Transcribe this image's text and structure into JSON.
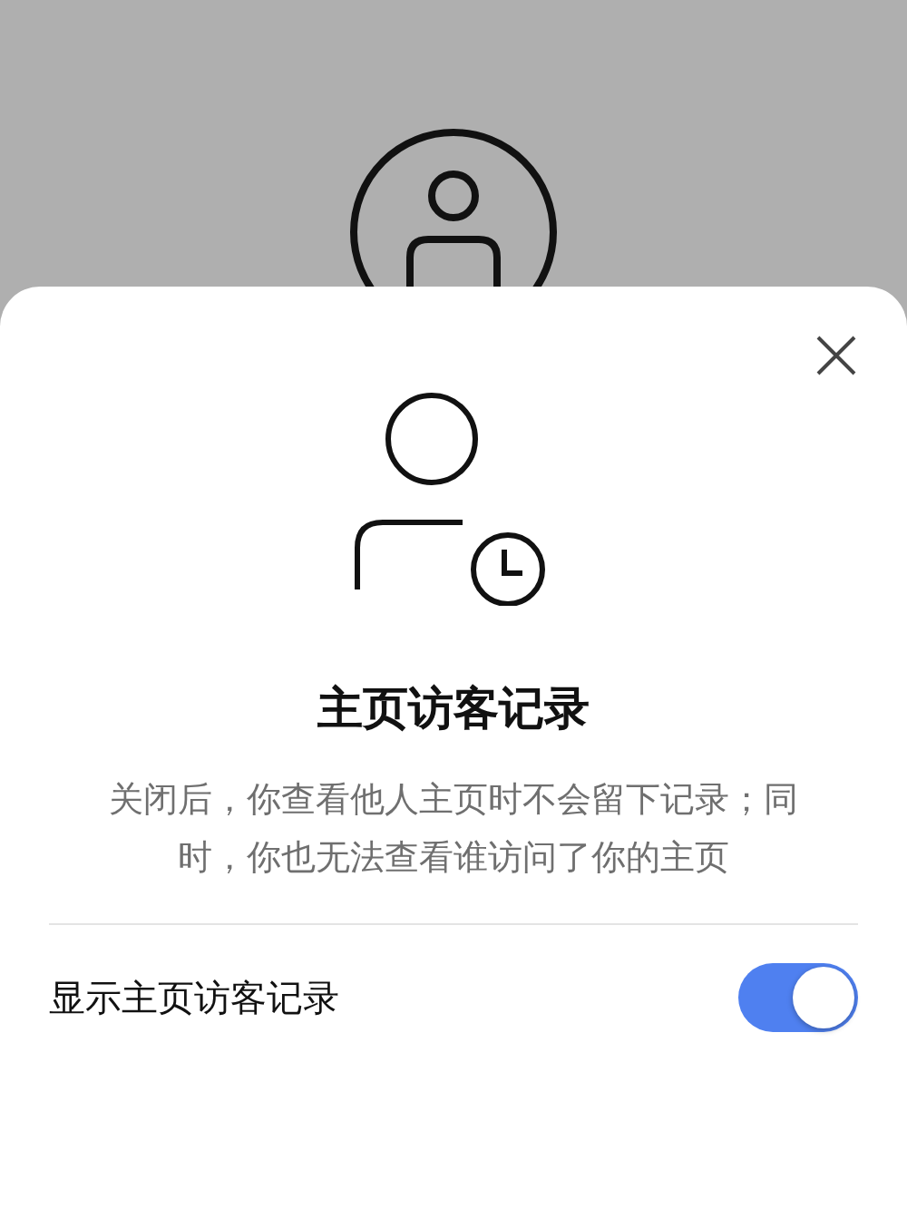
{
  "dialog": {
    "title": "主页访客记录",
    "description": "关闭后，你查看他人主页时不会留下记录；同时，你也无法查看谁访问了你的主页"
  },
  "setting": {
    "label": "显示主页访客记录",
    "on": true
  }
}
